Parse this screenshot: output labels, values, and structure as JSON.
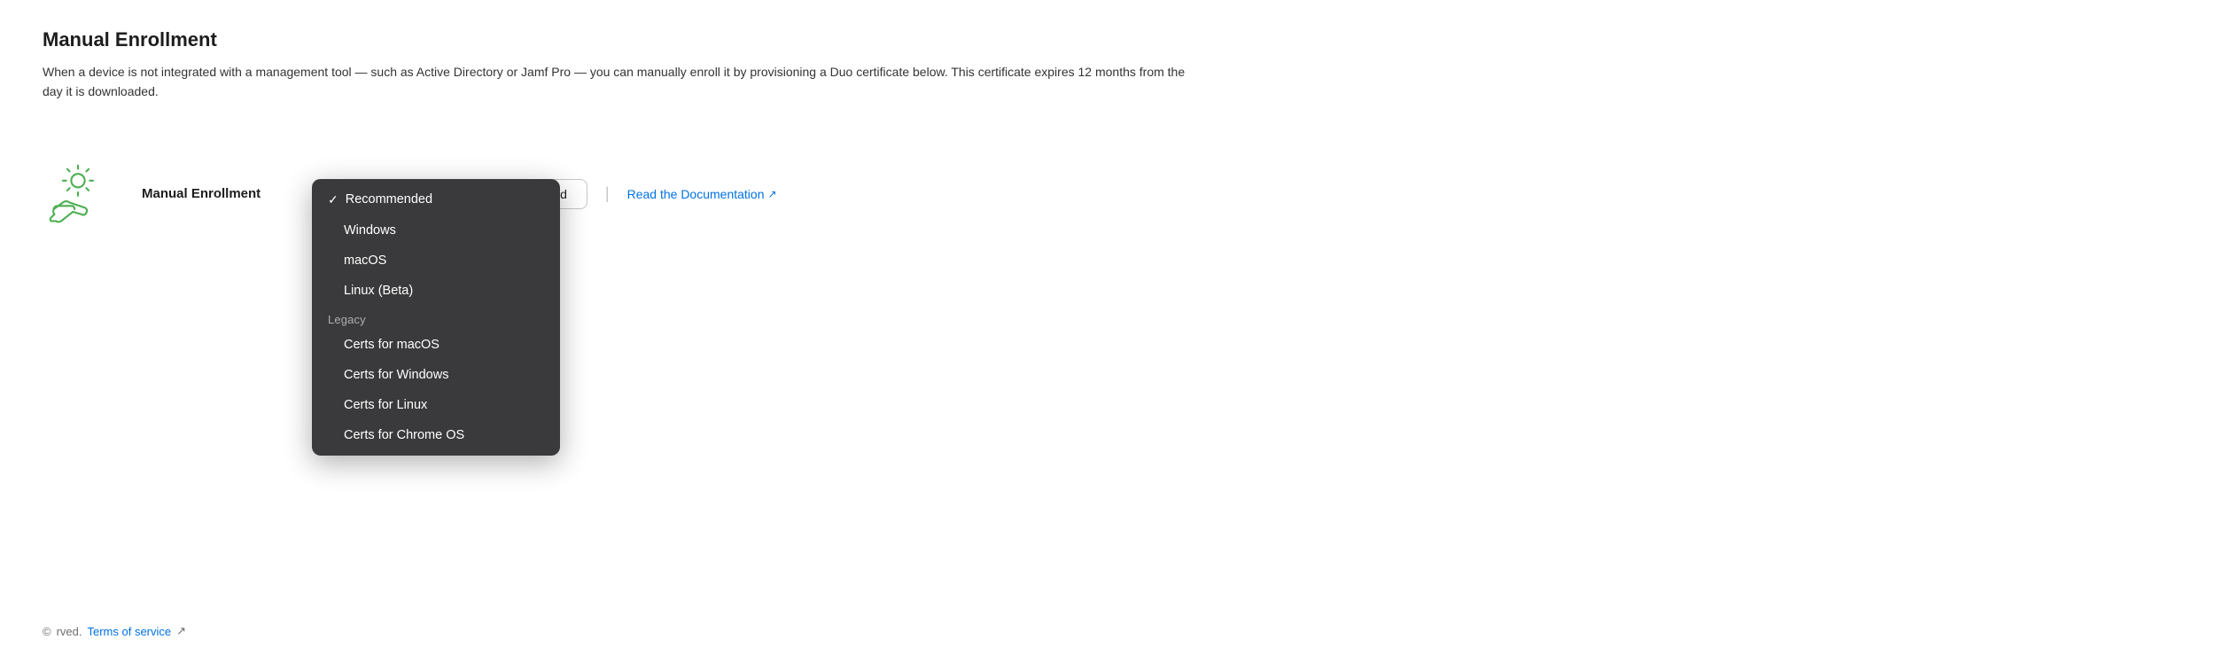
{
  "page": {
    "title": "Manual Enrollment",
    "description": "When a device is not integrated with a management tool — such as Active Directory or Jamf Pro — you can manually enroll it by provisioning a Duo certificate below. This certificate expires 12 months from the day it is downloaded."
  },
  "enrollment_section": {
    "label": "Manual Enrollment",
    "add_button_label": "Add",
    "doc_link_label": "Read the Documentation",
    "doc_link_icon": "external-link-icon"
  },
  "dropdown": {
    "selected_value": "Recommended",
    "groups": [
      {
        "group": "Recommended",
        "is_group_header": true,
        "items": [
          {
            "label": "Windows",
            "is_header": false
          },
          {
            "label": "macOS",
            "is_header": false
          },
          {
            "label": "Linux (Beta)",
            "is_header": false
          }
        ]
      },
      {
        "group": "Legacy",
        "is_group_header": true,
        "items": [
          {
            "label": "Certs for macOS",
            "is_header": false
          },
          {
            "label": "Certs for Windows",
            "is_header": false
          },
          {
            "label": "Certs for Linux",
            "is_header": false
          },
          {
            "label": "Certs for Chrome OS",
            "is_header": false
          }
        ]
      }
    ]
  },
  "footer": {
    "copyright": "©",
    "rights_text": "rved.",
    "terms_label": "Terms of service"
  },
  "colors": {
    "icon_green": "#4CAF50",
    "link_blue": "#0071e3",
    "dropdown_bg": "#3a3a3c"
  }
}
